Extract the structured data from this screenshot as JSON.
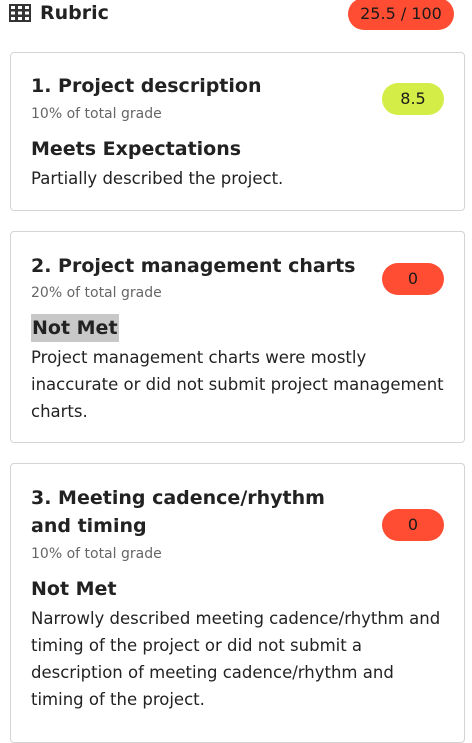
{
  "header": {
    "icon": "grid-icon",
    "title": "Rubric",
    "total_score": "25.5 / 100",
    "total_color": "#ff4d33"
  },
  "criteria": [
    {
      "title": "1. Project description",
      "weight": "10% of total grade",
      "score": "8.5",
      "score_color": "#d4ee47",
      "level": "Meets Expectations",
      "description": "Partially described the project."
    },
    {
      "title": "2. Project management charts",
      "weight": "20% of total grade",
      "score": "0",
      "score_color": "#ff4d33",
      "level": "Not Met",
      "description": "Project management charts were mostly inaccurate or did not submit project management charts."
    },
    {
      "title": "3. Meeting cadence/rhythm and timing",
      "weight": "10% of total grade",
      "score": "0",
      "score_color": "#ff4d33",
      "level": "Not Met",
      "description": "Narrowly described meeting cadence/rhythm and timing of the project or did not submit a description of meeting cadence/rhythm and timing of the project."
    }
  ]
}
